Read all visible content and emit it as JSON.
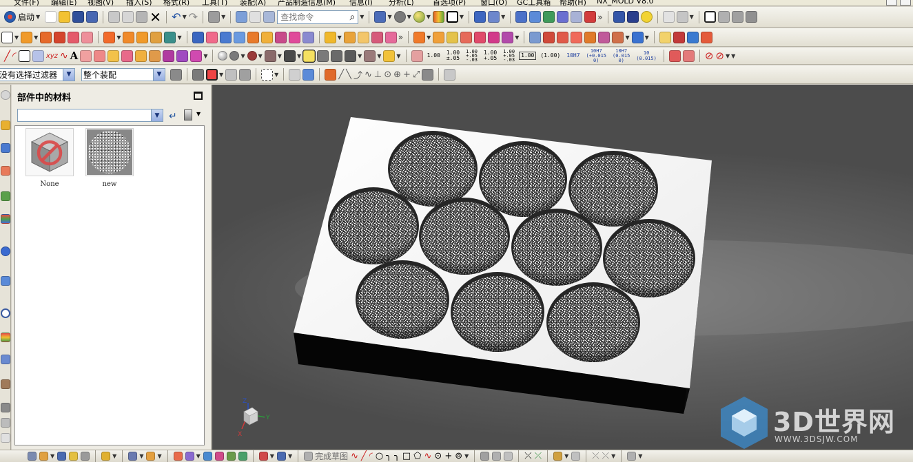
{
  "menu": {
    "items": [
      "文件(F)",
      "编辑(E)",
      "视图(V)",
      "插入(S)",
      "格式(R)",
      "工具(T)",
      "装配(A)",
      "产品制造信息(M)",
      "信息(I)",
      "分析(L)",
      "首选项(P)",
      "窗口(O)",
      "GC工具箱",
      "帮助(H)",
      "NX_MOLD V8.0"
    ]
  },
  "toolbar": {
    "start_label": "启动",
    "command_search_placeholder": "查找命令",
    "precision_buttons": [
      "1.00",
      "1.00\n±.05",
      "1.00\n+.05\n-.03",
      "1.00\n+.05",
      "1.00\n+.05\n-.03",
      "1.00",
      "(1.00)",
      "10H7",
      "10H7\n(+0.015\n0)",
      "10H7\n(0.015\n0)",
      "10\n(0.015)"
    ]
  },
  "selection_bar": {
    "filter_value": "没有选择过滤器",
    "scope_value": "整个装配"
  },
  "materials_panel": {
    "title": "部件中的材料",
    "library_selection": "",
    "materials": [
      {
        "label": "None",
        "icon": "no-material-cube-icon"
      },
      {
        "label": "new",
        "icon": "speckled-texture-icon"
      }
    ]
  },
  "bottom_toolbar": {
    "finish_sketch_label": "完成草图"
  },
  "watermark": {
    "brand": "3D世界网",
    "url": "WWW.3DSJW.COM"
  },
  "view_triad": {
    "axes": [
      "Z",
      "Y",
      "X"
    ]
  },
  "colors": {
    "viewport_background": "#636363",
    "part_top_face": "#f4f4f4",
    "part_side_face": "#060606",
    "toolbar_background": "#ece9d8",
    "watermark_blue": "#3a8fd4"
  }
}
